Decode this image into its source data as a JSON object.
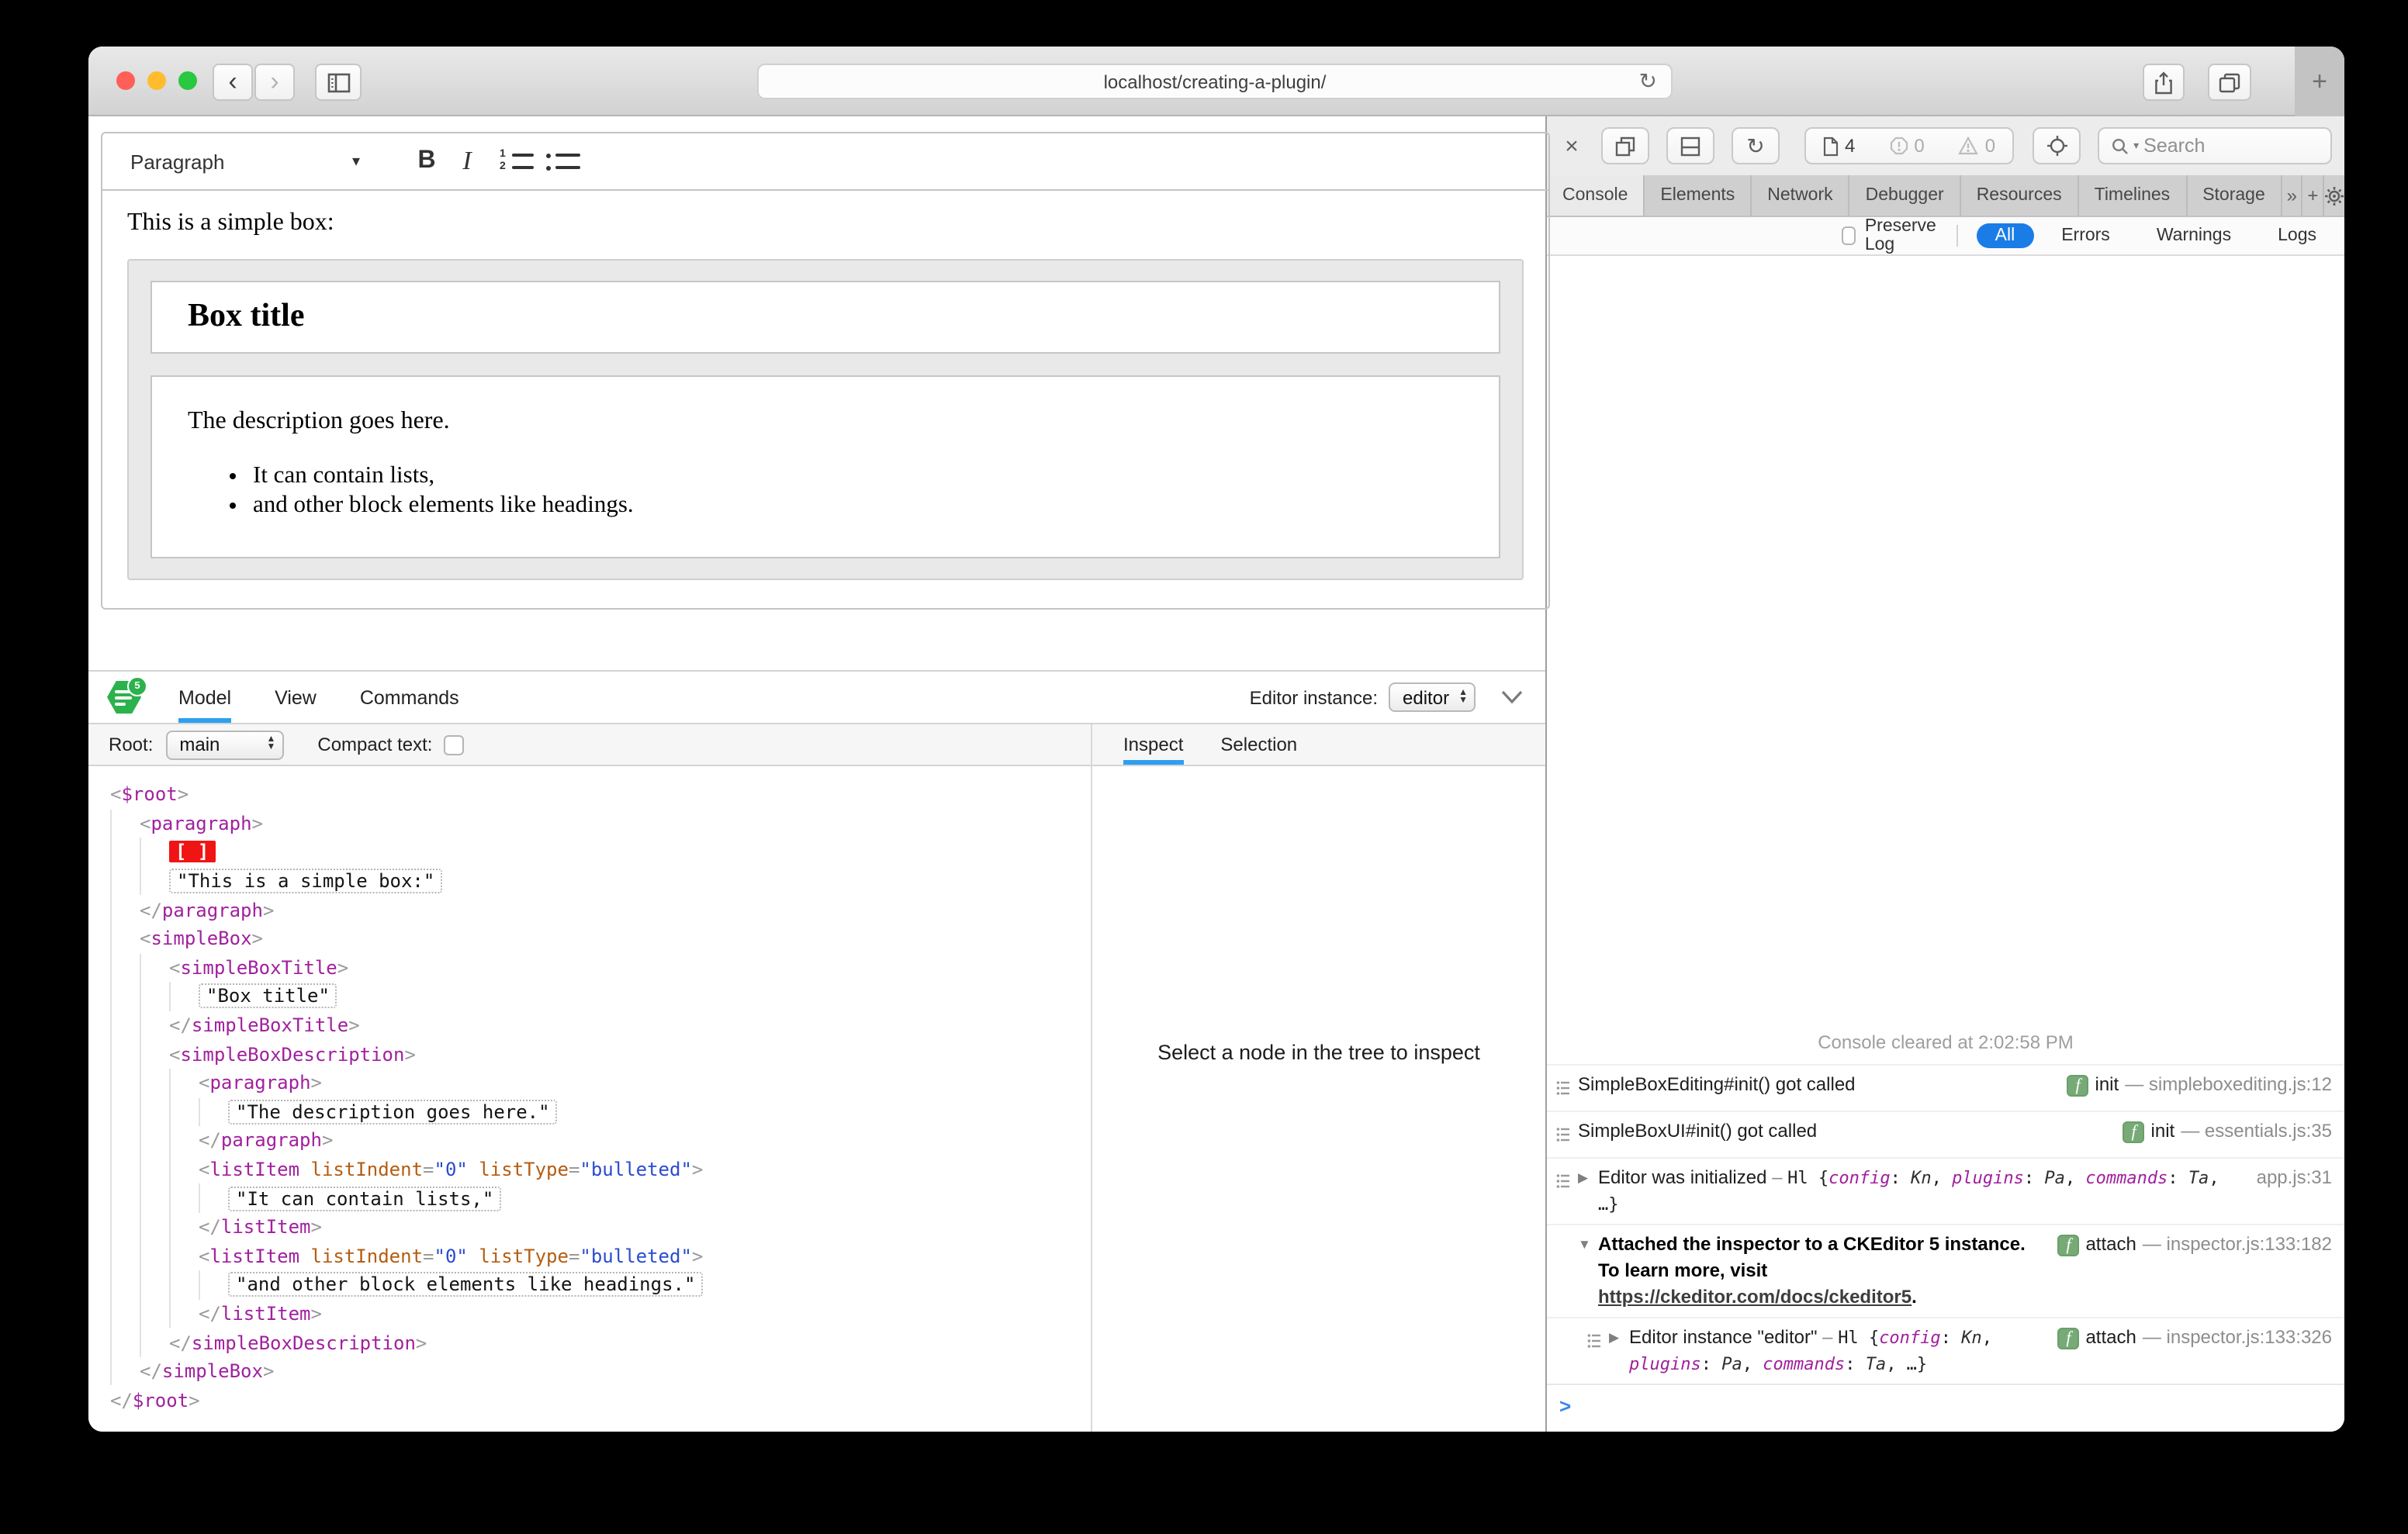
{
  "colors": {
    "accent": "#2e9ff0",
    "pillblue": "#1a7ce6",
    "tag": "#a1209e",
    "attr": "#b55c10",
    "val": "#2a4bd0",
    "sel": "#f01414",
    "fgreen": "#78aa78",
    "logo_green": "#2cb24c",
    "traffic_red": "#ff5f57",
    "traffic_yellow": "#febc2e",
    "traffic_green": "#28c840"
  },
  "browser": {
    "url": "localhost/creating-a-plugin/",
    "back_glyph": "‹",
    "forward_glyph": "›",
    "reload_glyph": "↻",
    "plus_glyph": "+"
  },
  "editor": {
    "toolbar": {
      "paragraph_label": "Paragraph",
      "dd_chevron": "▾",
      "bold_glyph": "B",
      "italic_glyph": "I",
      "num1": "1",
      "num2": "2"
    },
    "content": {
      "intro": "This is a simple box:",
      "box_title": "Box title",
      "description": "The description goes here.",
      "bullets": [
        "It can contain lists,",
        "and other block elements like headings."
      ]
    }
  },
  "inspector": {
    "logo_badge": "5",
    "tabs": [
      "Model",
      "View",
      "Commands"
    ],
    "active_tab": "Model",
    "instance_label": "Editor instance:",
    "instance_value": "editor",
    "root_label": "Root:",
    "root_value": "main",
    "compact_label": "Compact text:",
    "right_tabs": [
      "Inspect",
      "Selection"
    ],
    "right_active": "Inspect",
    "empty_text": "Select a node in the tree to inspect",
    "tree": [
      {
        "i": 0,
        "tokens": [
          [
            "br",
            "<"
          ],
          [
            "tag",
            "$root"
          ],
          [
            "br",
            ">"
          ]
        ]
      },
      {
        "i": 1,
        "tokens": [
          [
            "br",
            "<"
          ],
          [
            "tag",
            "paragraph"
          ],
          [
            "br",
            ">"
          ]
        ]
      },
      {
        "i": 2,
        "tokens": [
          [
            "sel",
            "[ ]"
          ]
        ]
      },
      {
        "i": 2,
        "tokens": [
          [
            "str",
            "\"This is a simple box:\""
          ]
        ]
      },
      {
        "i": 1,
        "tokens": [
          [
            "br",
            "</"
          ],
          [
            "tag",
            "paragraph"
          ],
          [
            "br",
            ">"
          ]
        ]
      },
      {
        "i": 1,
        "tokens": [
          [
            "br",
            "<"
          ],
          [
            "tag",
            "simpleBox"
          ],
          [
            "br",
            ">"
          ]
        ]
      },
      {
        "i": 2,
        "tokens": [
          [
            "br",
            "<"
          ],
          [
            "tag",
            "simpleBoxTitle"
          ],
          [
            "br",
            ">"
          ]
        ]
      },
      {
        "i": 3,
        "tokens": [
          [
            "str",
            "\"Box title\""
          ]
        ]
      },
      {
        "i": 2,
        "tokens": [
          [
            "br",
            "</"
          ],
          [
            "tag",
            "simpleBoxTitle"
          ],
          [
            "br",
            ">"
          ]
        ]
      },
      {
        "i": 2,
        "tokens": [
          [
            "br",
            "<"
          ],
          [
            "tag",
            "simpleBoxDescription"
          ],
          [
            "br",
            ">"
          ]
        ]
      },
      {
        "i": 3,
        "tokens": [
          [
            "br",
            "<"
          ],
          [
            "tag",
            "paragraph"
          ],
          [
            "br",
            ">"
          ]
        ]
      },
      {
        "i": 4,
        "tokens": [
          [
            "str",
            "\"The description goes here.\""
          ]
        ]
      },
      {
        "i": 3,
        "tokens": [
          [
            "br",
            "</"
          ],
          [
            "tag",
            "paragraph"
          ],
          [
            "br",
            ">"
          ]
        ]
      },
      {
        "i": 3,
        "tokens": [
          [
            "br",
            "<"
          ],
          [
            "tag",
            "listItem"
          ],
          [
            "pl",
            " "
          ],
          [
            "attr",
            "listIndent"
          ],
          [
            "eq",
            "="
          ],
          [
            "val",
            "\"0\""
          ],
          [
            "pl",
            " "
          ],
          [
            "attr",
            "listType"
          ],
          [
            "eq",
            "="
          ],
          [
            "val",
            "\"bulleted\""
          ],
          [
            "br",
            ">"
          ]
        ]
      },
      {
        "i": 4,
        "tokens": [
          [
            "str",
            "\"It can contain lists,\""
          ]
        ]
      },
      {
        "i": 3,
        "tokens": [
          [
            "br",
            "</"
          ],
          [
            "tag",
            "listItem"
          ],
          [
            "br",
            ">"
          ]
        ]
      },
      {
        "i": 3,
        "tokens": [
          [
            "br",
            "<"
          ],
          [
            "tag",
            "listItem"
          ],
          [
            "pl",
            " "
          ],
          [
            "attr",
            "listIndent"
          ],
          [
            "eq",
            "="
          ],
          [
            "val",
            "\"0\""
          ],
          [
            "pl",
            " "
          ],
          [
            "attr",
            "listType"
          ],
          [
            "eq",
            "="
          ],
          [
            "val",
            "\"bulleted\""
          ],
          [
            "br",
            ">"
          ]
        ]
      },
      {
        "i": 4,
        "tokens": [
          [
            "str",
            "\"and other block elements like headings.\""
          ]
        ]
      },
      {
        "i": 3,
        "tokens": [
          [
            "br",
            "</"
          ],
          [
            "tag",
            "listItem"
          ],
          [
            "br",
            ">"
          ]
        ]
      },
      {
        "i": 2,
        "tokens": [
          [
            "br",
            "</"
          ],
          [
            "tag",
            "simpleBoxDescription"
          ],
          [
            "br",
            ">"
          ]
        ]
      },
      {
        "i": 1,
        "tokens": [
          [
            "br",
            "</"
          ],
          [
            "tag",
            "simpleBox"
          ],
          [
            "br",
            ">"
          ]
        ]
      },
      {
        "i": 0,
        "tokens": [
          [
            "br",
            "</"
          ],
          [
            "tag",
            "$root"
          ],
          [
            "br",
            ">"
          ]
        ]
      }
    ]
  },
  "devtools": {
    "close_glyph": "×",
    "doc_count": "4",
    "error_count": "0",
    "warn_count": "0",
    "search_placeholder": "Search",
    "search_chevron": "▾",
    "tabs": [
      "Console",
      "Elements",
      "Network",
      "Debugger",
      "Resources",
      "Timelines",
      "Storage"
    ],
    "active_tab": "Console",
    "overflow_glyph": "»",
    "add_glyph": "+",
    "filter": {
      "preserve_label": "Preserve Log",
      "pills": [
        "All",
        "Errors",
        "Warnings",
        "Logs"
      ],
      "active_pill": "All"
    },
    "console": {
      "cleared_text": "Console cleared at 2:02:58 PM",
      "prompt_glyph": ">",
      "entries": [
        {
          "icon": true,
          "disc": "",
          "nested": false,
          "segs": [
            [
              "t",
              "SimpleBoxEditing#init() got called"
            ]
          ],
          "badge": "f",
          "fn": "init",
          "loc": "— simpleboxediting.js:12"
        },
        {
          "icon": true,
          "disc": "",
          "nested": false,
          "segs": [
            [
              "t",
              "SimpleBoxUI#init() got called"
            ]
          ],
          "badge": "f",
          "fn": "init",
          "loc": "— essentials.js:35"
        },
        {
          "icon": true,
          "disc": "▶",
          "nested": false,
          "segs": [
            [
              "t",
              "Editor was initialized"
            ],
            [
              "g",
              " – "
            ],
            [
              "m",
              "Hl "
            ],
            [
              "m",
              "{"
            ],
            [
              "p",
              "config"
            ],
            [
              "m",
              ": "
            ],
            [
              "v",
              "Kn"
            ],
            [
              "m",
              ", "
            ],
            [
              "p",
              "plugins"
            ],
            [
              "m",
              ": "
            ],
            [
              "v",
              "Pa"
            ],
            [
              "m",
              ", "
            ],
            [
              "p",
              "commands"
            ],
            [
              "m",
              ": "
            ],
            [
              "v",
              "Ta"
            ],
            [
              "m",
              ", …}"
            ]
          ],
          "badge": "",
          "fn": "",
          "loc": "app.js:31"
        },
        {
          "icon": false,
          "disc": "▼",
          "nested": false,
          "segs": [
            [
              "b",
              "Attached the inspector to a CKEditor 5 instance. To learn more, visit "
            ],
            [
              "l",
              "https://ckeditor.com/docs/ckeditor5"
            ],
            [
              "b",
              "."
            ]
          ],
          "badge": "f",
          "fn": "attach",
          "loc": "— inspector.js:133:182"
        },
        {
          "icon": true,
          "disc": "▶",
          "nested": true,
          "segs": [
            [
              "t",
              "Editor instance \"editor\""
            ],
            [
              "g",
              " – "
            ],
            [
              "m",
              "Hl "
            ],
            [
              "m",
              "{"
            ],
            [
              "p",
              "config"
            ],
            [
              "m",
              ": "
            ],
            [
              "v",
              "Kn"
            ],
            [
              "m",
              ", "
            ],
            [
              "p",
              "plugins"
            ],
            [
              "m",
              ": "
            ],
            [
              "v",
              "Pa"
            ],
            [
              "m",
              ", "
            ],
            [
              "p",
              "commands"
            ],
            [
              "m",
              ": "
            ],
            [
              "v",
              "Ta"
            ],
            [
              "m",
              ", …}"
            ]
          ],
          "badge": "f",
          "fn": "attach",
          "loc": "— inspector.js:133:326"
        }
      ]
    }
  }
}
